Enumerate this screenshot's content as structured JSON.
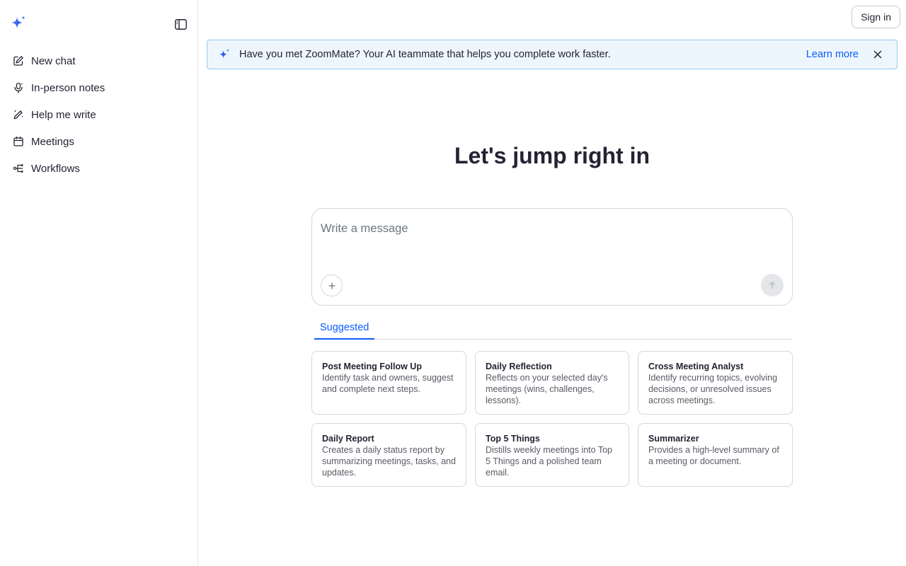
{
  "sidebar": {
    "logo_icon": "zoom-ai-sparkle-icon",
    "toggle_icon": "sidebar-toggle-icon",
    "items": [
      {
        "label": "New chat",
        "icon": "edit-icon"
      },
      {
        "label": "In-person notes",
        "icon": "microphone-icon"
      },
      {
        "label": "Help me write",
        "icon": "pen-sparkle-icon"
      },
      {
        "label": "Meetings",
        "icon": "calendar-icon"
      },
      {
        "label": "Workflows",
        "icon": "workflow-icon"
      }
    ]
  },
  "header": {
    "signin_label": "Sign in"
  },
  "banner": {
    "text": "Have you met ZoomMate? Your AI teammate that helps you complete work faster.",
    "link_label": "Learn more",
    "icon": "sparkle-icon",
    "close_icon": "close-icon"
  },
  "main": {
    "heading": "Let's jump right in",
    "composer": {
      "placeholder": "Write a message",
      "value": "",
      "add_icon": "plus-icon",
      "send_icon": "arrow-up-icon"
    },
    "tabs": [
      {
        "label": "Suggested",
        "active": true
      }
    ],
    "suggestions": [
      {
        "title": "Post Meeting Follow Up",
        "description": "Identify task and owners, suggest and complete next steps."
      },
      {
        "title": "Daily Reflection",
        "description": "Reflects on your selected day's meetings (wins, challenges, lessons)."
      },
      {
        "title": "Cross Meeting Analyst",
        "description": "Identify recurring topics, evolving decisions, or unresolved issues across meetings."
      },
      {
        "title": "Daily Report",
        "description": "Creates a daily status report by summarizing meetings, tasks, and updates."
      },
      {
        "title": "Top 5 Things",
        "description": "Distills weekly meetings into Top 5 Things and a polished team email."
      },
      {
        "title": "Summarizer",
        "description": "Provides a high-level summary of a meeting or document."
      }
    ]
  },
  "colors": {
    "accent": "#0b5cff",
    "banner_bg": "#eef6fd",
    "banner_border": "#9ac6ee",
    "text": "#232333"
  }
}
